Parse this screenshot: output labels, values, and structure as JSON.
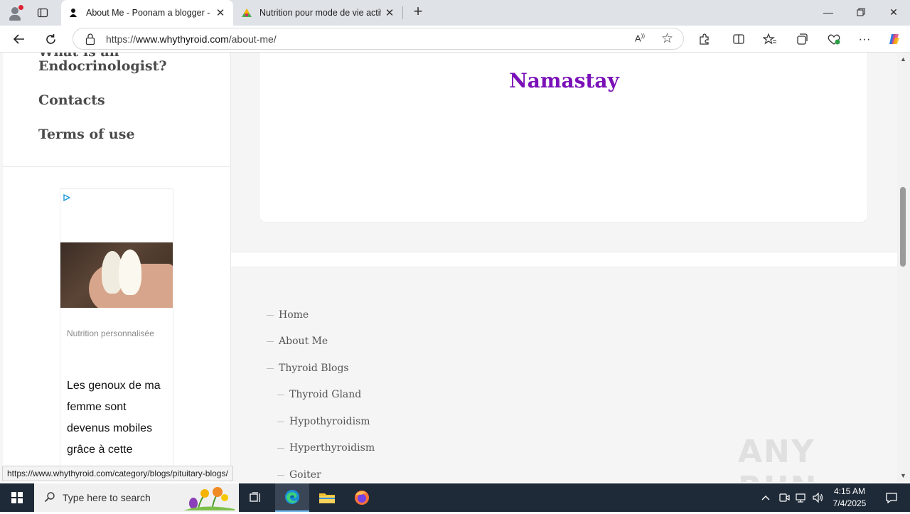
{
  "browser": {
    "tabs": [
      {
        "label": "About Me - Poonam a blogger - I",
        "active": true
      },
      {
        "label": "Nutrition pour mode de vie actif",
        "active": false
      }
    ],
    "url_prefix": "https://",
    "url_domain": "www.whythyroid.com",
    "url_path": "/about-me/",
    "read_aloud": "A",
    "status_url": "https://www.whythyroid.com/category/blogs/pituitary-blogs/"
  },
  "sidebar": {
    "menu": [
      {
        "label": "What is an"
      },
      {
        "label": "Endocrinologist?"
      },
      {
        "label": "Contacts"
      },
      {
        "label": "Terms of use"
      }
    ]
  },
  "ad": {
    "sponsor": "Nutrition personnalisée",
    "text": "Les genoux de ma femme sont devenus mobiles grâce à cette"
  },
  "main": {
    "greeting": "Namastay",
    "greeting_color": "#7a10b8"
  },
  "footer_nav": [
    {
      "label": "Home",
      "level": 0
    },
    {
      "label": "About Me",
      "level": 0
    },
    {
      "label": "Thyroid Blogs",
      "level": 0
    },
    {
      "label": "Thyroid Gland",
      "level": 1
    },
    {
      "label": "Hypothyroidism",
      "level": 1
    },
    {
      "label": "Hyperthyroidism",
      "level": 1
    },
    {
      "label": "Goiter",
      "level": 1
    }
  ],
  "watermark": "ANY RUN",
  "taskbar": {
    "search_placeholder": "Type here to search",
    "time": "4:15 AM",
    "date": "7/4/2025"
  }
}
